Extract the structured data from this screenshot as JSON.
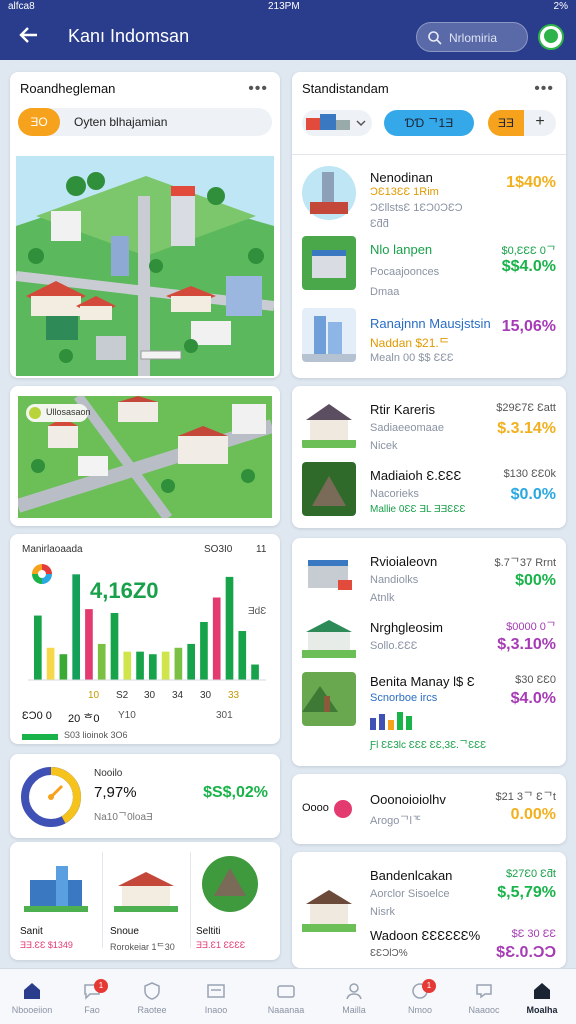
{
  "status_bar": {
    "carrier": "alfca8",
    "time": "213PM",
    "battery": "2%"
  },
  "header": {
    "title": "Kanı Indomsan",
    "search_placeholder": "Nrlomiria"
  },
  "left_top": {
    "title": "Roandhegleman",
    "toggle_a": "ƎO",
    "toggle_b": "Oyten blhajamian"
  },
  "left_map2": {
    "badge": "Ullosasaon"
  },
  "chart_card": {
    "title": "Manirlaoaada",
    "subtitle": "SO3I0",
    "subtitle2": "11",
    "big_value": "4,16Z0",
    "side_label": "ƎdƐ",
    "tick_labels": [
      "10",
      "S2",
      "30",
      "34",
      "30",
      "33"
    ],
    "bottom_left": "ƐƆ0 0",
    "bottom_mid": "20 ᄒ0",
    "bottom_mid2": "Y10",
    "bottom_right": "301",
    "legend_label": "S03 lioinok 3O6"
  },
  "chart_data": {
    "type": "bar",
    "series": [
      {
        "values": [
          50,
          25,
          20,
          82,
          55,
          28,
          52,
          22,
          22,
          20,
          22,
          25,
          28,
          45,
          64,
          80,
          38,
          12
        ]
      }
    ],
    "ylim": [
      0,
      90
    ],
    "colors": [
      "#17a34a",
      "#f6d84a",
      "#3aaa35",
      "#15a05a",
      "#e33a6f",
      "#7ac143",
      "#17a34a",
      "#cfe54b",
      "#17a34a",
      "#17a34a",
      "#cfe54b",
      "#7ac143",
      "#17a34a",
      "#17a34a",
      "#e33a6f",
      "#17a34a",
      "#17a34a",
      "#17a34a"
    ]
  },
  "gauge_card": {
    "label": "Nooilo",
    "value": "7,97%",
    "sub": "Na10ᄀ0loaƎ",
    "amount": "$S$,02%",
    "gauge_fraction": 0.42
  },
  "mini_tiles": [
    {
      "name": "Sanit",
      "price": "ƎƎ.ƐƐ $1349"
    },
    {
      "name": "Snoue",
      "price": "Rorokeiar 1ᄃ30"
    },
    {
      "name": "Seltiti",
      "price": "ƎƎ.Ɛ1 ƐƐƐƐ"
    }
  ],
  "right_top": {
    "title": "Standistandam",
    "pill_a": "ƎƎ",
    "pill_b": "ƊƊ ᄀ1Ǝ",
    "pill_c": "ƎƎ",
    "pill_plus": "+"
  },
  "right_list_1": [
    {
      "name": "Nenodinan",
      "sub": "ƆƐllstsƐ 1ƐƆ0ƆƐƆ",
      "sub2": "Ɛƌƌ",
      "highlight": "ƆƐ13ƐƐ 1Rim",
      "price_big": "1$40%",
      "price_color": "#f2b01e"
    },
    {
      "name": "Nlo lanpen",
      "sub": "Pocaajoonces",
      "sub2": "Dmaa",
      "highlight": "",
      "price_small": "$0,ƐƐƐ 0ᄀ",
      "price_big": "$$4.0%",
      "price_color": "#19b34a"
    },
    {
      "name": "Ranajnnn Mausjstsin",
      "sub": "Naddan $21.ᄃ",
      "sub2": "Mealn 00 $$ ƐƐƐ",
      "highlight": "",
      "price_big": "15,06%",
      "price_color": "#a63bb5"
    }
  ],
  "right_list_2": [
    {
      "name": "Rtir Kareris",
      "sub": "Sadiaeeomaae",
      "sub2": "Nicek",
      "price_small": "$29Ɛ7Ɛ Ɛatt",
      "price_big": "$.3.14%",
      "price_color": "#f2b01e"
    },
    {
      "name": "Madiaioh Ɛ.ƐƐƐ",
      "sub": "Nacorieks",
      "sub2": "Mallie 0ƐƐ ƎL ƎƎƐƐƐ",
      "price_small": "$130 ƐƐ0k",
      "price_big": "$0.0%",
      "price_color": "#2aa8e0"
    }
  ],
  "right_list_3": [
    {
      "name": "Rvioialeovn",
      "sub": "Nandiolks",
      "sub2": "Atnlk",
      "price_small": "$.7ᄀ37 Rrnt",
      "price_big": "$00%",
      "price_color": "#19b34a"
    },
    {
      "name": "Nrghgleosim",
      "sub": "Sollo.ƐƐƐ",
      "sub2": "",
      "price_small": "$0000 0ᄀ",
      "price_big": "$,3.10%",
      "price_color": "#a63bb5"
    },
    {
      "name": "Benita Manay l$ Ɛ",
      "sub": "Scnorboe ircs",
      "sub2": "Ƒl ƐƐ3lc ƐƐƐ ƐƐ,3Ɛ.ᄀƐƐƐ",
      "price_small": "$30 ƐƐ0",
      "price_big": "$4.0%",
      "price_color": "#a63bb5"
    }
  ],
  "right_card_4": {
    "label": "Oooo",
    "title": "Ooonoioiolhv",
    "sub": "Arogoᄀlᄀᄃ",
    "price_small": "$21 3ᄀ Ɛᄀt",
    "price_big": "0.00%",
    "price_color": "#f2b01e"
  },
  "right_list_5": [
    {
      "name": "Bandenlcakan",
      "sub": "Aorclor Sisoelce",
      "sub2": "Nisrk",
      "price_small": "$27Ɛ0 Ɛƌt",
      "price_big": "$,5,79%",
      "price_color": "#19b34a"
    },
    {
      "name": "Wadoon ƐƐƐƐƐƐ%",
      "sub": "ƐƐƆlƆ%",
      "sub2": "",
      "price_small": "$Ɛ 30 ƐƐ",
      "price_big": "$Ɛ.0.ƆƆ",
      "price_color": "#a63bb5"
    }
  ],
  "bottom_nav": [
    {
      "label": "Nbooeiion",
      "badge": ""
    },
    {
      "label": "Fao",
      "badge": "1"
    },
    {
      "label": "Raotee",
      "badge": ""
    },
    {
      "label": "Inaoo",
      "badge": ""
    },
    {
      "label": "Naaanaa",
      "badge": ""
    },
    {
      "label": "Mailla",
      "badge": ""
    },
    {
      "label": "Nmoo",
      "badge": "1"
    },
    {
      "label": "Naaɑoc",
      "badge": ""
    },
    {
      "label": "Moalha",
      "badge": ""
    }
  ],
  "colors": {
    "header": "#2a3d8c",
    "accent_orange": "#f6a21c",
    "accent_blue": "#35a8ea",
    "green": "#19b34a",
    "magenta": "#a63bb5"
  }
}
